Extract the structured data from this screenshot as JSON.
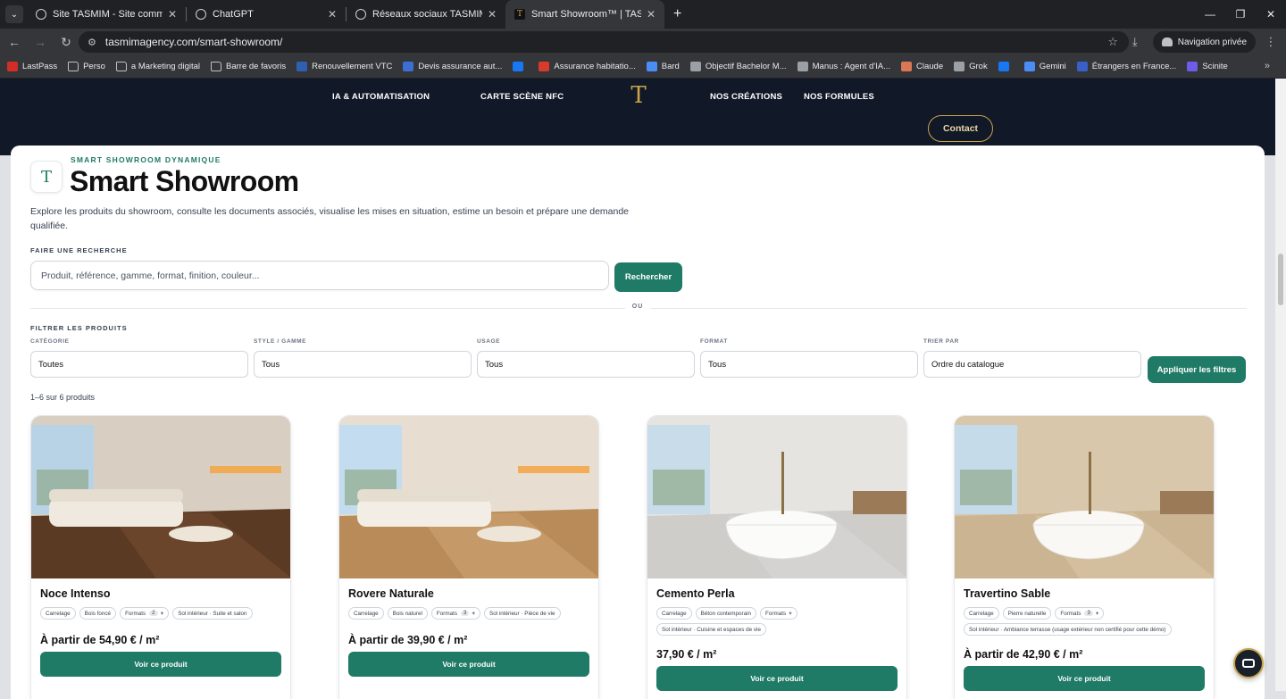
{
  "browser": {
    "tabs": [
      {
        "label": "Site TASMIM - Site commercial",
        "active": false
      },
      {
        "label": "ChatGPT",
        "active": false
      },
      {
        "label": "Réseaux sociaux TASMIM - Mou",
        "active": false
      },
      {
        "label": "Smart Showroom™ | TASMIM -",
        "active": true
      }
    ],
    "url": "tasmimagency.com/smart-showroom/",
    "incognito_label": "Navigation privée",
    "bookmarks": [
      {
        "label": "LastPass",
        "color": "#d32d27",
        "folder": false
      },
      {
        "label": "Perso",
        "color": "",
        "folder": true
      },
      {
        "label": "a Marketing digital",
        "color": "",
        "folder": true
      },
      {
        "label": "Barre de favoris",
        "color": "",
        "folder": true
      },
      {
        "label": "Renouvellement VTC",
        "color": "#2f5fb3",
        "folder": false
      },
      {
        "label": "Devis assurance aut...",
        "color": "#3b6fd1",
        "folder": false
      },
      {
        "label": "",
        "color": "#1877f2",
        "folder": false
      },
      {
        "label": "Assurance habitatio...",
        "color": "#d93a2b",
        "folder": false
      },
      {
        "label": "Bard",
        "color": "#4b8cf5",
        "folder": false
      },
      {
        "label": "Objectif Bachelor M...",
        "color": "#9aa0a6",
        "folder": false
      },
      {
        "label": "Manus : Agent d'IA...",
        "color": "#9aa0a6",
        "folder": false
      },
      {
        "label": "Claude",
        "color": "#d97757",
        "folder": false
      },
      {
        "label": "Grok",
        "color": "#9aa0a6",
        "folder": false
      },
      {
        "label": "",
        "color": "#1877f2",
        "folder": false
      },
      {
        "label": "Gemini",
        "color": "#4b8cf5",
        "folder": false
      },
      {
        "label": "Étrangers en France...",
        "color": "#3a5fc8",
        "folder": false
      },
      {
        "label": "Scinite",
        "color": "#6c5ce7",
        "folder": false
      }
    ]
  },
  "site": {
    "nav": [
      {
        "label": "IA & AUTOMATISATION"
      },
      {
        "label": "CARTE SCÈNE NFC"
      },
      {
        "label": "NOS CRÉATIONS"
      },
      {
        "label": "NOS FORMULES"
      }
    ],
    "logo_glyph": "T",
    "contact_label": "Contact",
    "accent": "#1f7a66",
    "gold": "#c9a44a"
  },
  "showroom": {
    "eyebrow": "SMART SHOWROOM DYNAMIQUE",
    "title": "Smart Showroom",
    "intro": "Explore les produits du showroom, consulte les documents associés, visualise les mises en situation, estime un besoin et prépare une demande qualifiée.",
    "search_label": "FAIRE UNE RECHERCHE",
    "search_placeholder": "Produit, référence, gamme, format, finition, couleur...",
    "search_button": "Rechercher",
    "or_label": "OU",
    "filter_label": "FILTRER LES PRODUITS",
    "filters": [
      {
        "label": "CATÉGORIE",
        "value": "Toutes"
      },
      {
        "label": "STYLE / GAMME",
        "value": "Tous"
      },
      {
        "label": "USAGE",
        "value": "Tous"
      },
      {
        "label": "FORMAT",
        "value": "Tous"
      },
      {
        "label": "TRIER PAR",
        "value": "Ordre du catalogue"
      }
    ],
    "apply_button": "Appliquer les filtres",
    "result_count": "1–6 sur 6 produits"
  },
  "products": [
    {
      "name": "Noce Intenso",
      "scene": "living-dark",
      "tags": {
        "category": "Carrelage",
        "style": "Bois foncé",
        "formats_label": "Formats",
        "formats_count": "2",
        "usage": "Sol intérieur · Suite et salon"
      },
      "price": "À partir de 54,90 € / m²",
      "cta": "Voir ce produit"
    },
    {
      "name": "Rovere Naturale",
      "scene": "living-light",
      "tags": {
        "category": "Carrelage",
        "style": "Bois naturel",
        "formats_label": "Formats",
        "formats_count": "3",
        "usage": "Sol intérieur · Pièce de vie"
      },
      "price": "À partir de 39,90 € / m²",
      "cta": "Voir ce produit"
    },
    {
      "name": "Cemento Perla",
      "scene": "bath-grey",
      "tags": {
        "category": "Carrelage",
        "style": "Béton contemporain",
        "formats_label": "Formats",
        "formats_count": "",
        "usage": "Sol intérieur · Cuisine et espaces de vie"
      },
      "price": "37,90 € / m²",
      "cta": "Voir ce produit"
    },
    {
      "name": "Travertino Sable",
      "scene": "bath-beige",
      "tags": {
        "category": "Carrelage",
        "style": "Pierre naturelle",
        "formats_label": "Formats",
        "formats_count": "3",
        "usage": "Sol intérieur · Ambiance terrasse (usage extérieur non certifié pour cette démo)"
      },
      "price": "À partir de 42,90 € / m²",
      "cta": "Voir ce produit"
    }
  ]
}
